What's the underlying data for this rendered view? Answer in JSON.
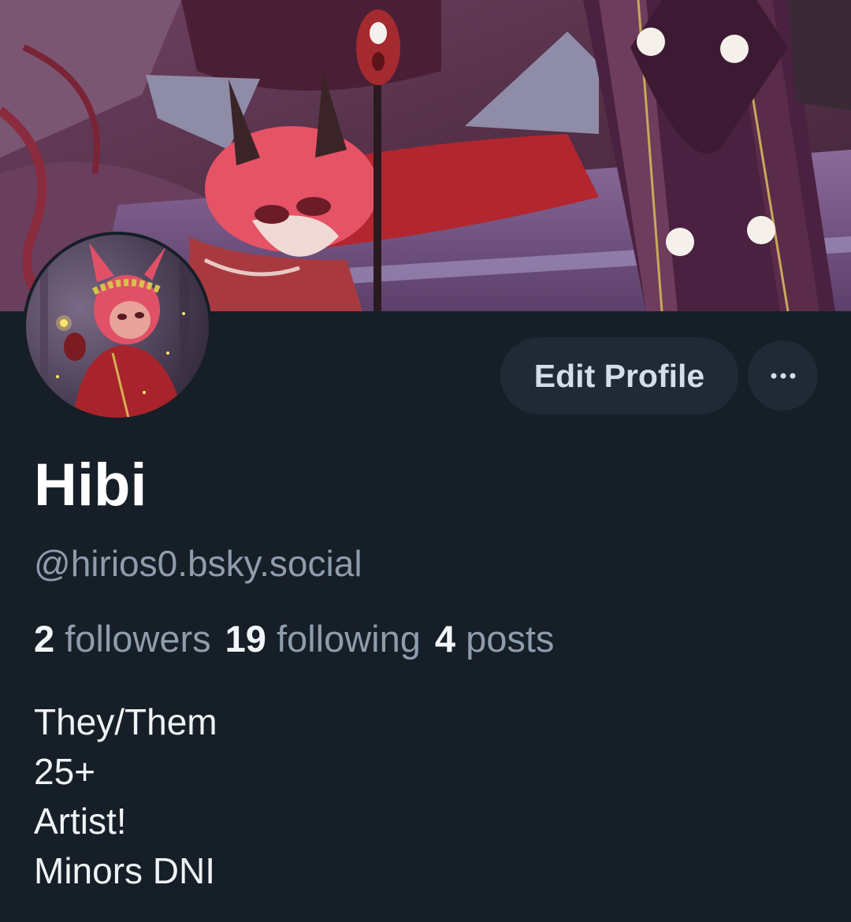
{
  "profile": {
    "display_name": "Hibi",
    "handle": "@hirios0.bsky.social",
    "banner_alt": "profile-banner",
    "avatar_alt": "profile-avatar"
  },
  "actions": {
    "edit_label": "Edit Profile",
    "more_icon": "ellipsis-horizontal-icon"
  },
  "stats": {
    "followers_count": "2",
    "followers_label": "followers",
    "following_count": "19",
    "following_label": "following",
    "posts_count": "4",
    "posts_label": "posts"
  },
  "bio": {
    "lines": [
      "They/Them",
      "25+",
      "Artist!",
      "Minors DNI"
    ]
  },
  "colors": {
    "background": "#161e27",
    "button_bg": "#1f2a36",
    "primary_text": "#ffffff",
    "secondary_text": "#8e9cab"
  }
}
